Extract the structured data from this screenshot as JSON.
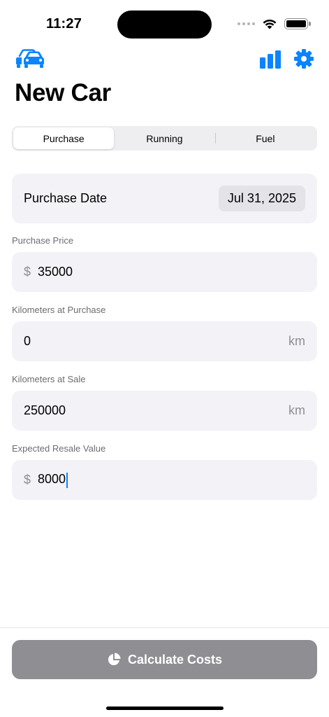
{
  "status_bar": {
    "time": "11:27"
  },
  "nav": {
    "title": "New Car",
    "left_icon": "cars-icon",
    "right_icons": [
      "bar-chart-icon",
      "gear-icon"
    ],
    "accent_color": "#0a84ff"
  },
  "tabs": [
    {
      "label": "Purchase",
      "selected": true
    },
    {
      "label": "Running",
      "selected": false
    },
    {
      "label": "Fuel",
      "selected": false
    }
  ],
  "purchase_date": {
    "label": "Purchase Date",
    "value": "Jul 31, 2025"
  },
  "fields": {
    "purchase_price": {
      "label": "Purchase Price",
      "prefix": "$",
      "value": "35000"
    },
    "km_at_purchase": {
      "label": "Kilometers at Purchase",
      "value": "0",
      "suffix": "km"
    },
    "km_at_sale": {
      "label": "Kilometers at Sale",
      "value": "250000",
      "suffix": "km"
    },
    "resale_value": {
      "label": "Expected Resale Value",
      "prefix": "$",
      "value": "8000"
    }
  },
  "calculate_button": {
    "label": "Calculate Costs",
    "icon": "pie-chart-icon",
    "color": "#8e8e93"
  }
}
